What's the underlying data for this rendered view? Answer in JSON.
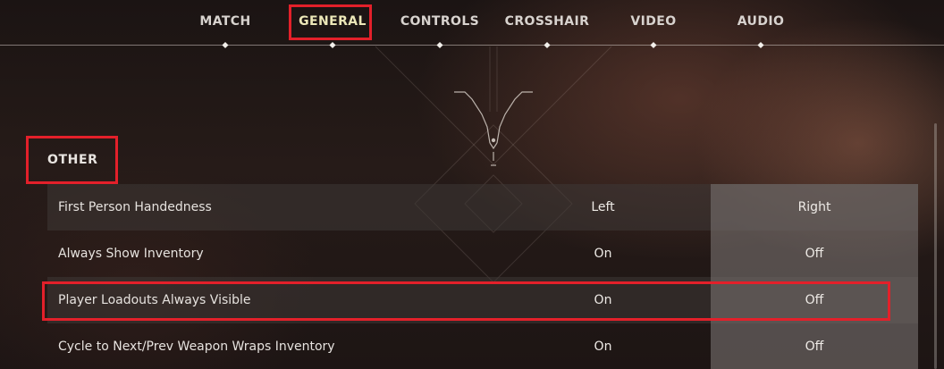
{
  "nav": {
    "tabs": [
      {
        "label": "MATCH",
        "active": false
      },
      {
        "label": "GENERAL",
        "active": true
      },
      {
        "label": "CONTROLS",
        "active": false
      },
      {
        "label": "CROSSHAIR",
        "active": false
      },
      {
        "label": "VIDEO",
        "active": false
      },
      {
        "label": "AUDIO",
        "active": false
      }
    ]
  },
  "section": {
    "title": "OTHER"
  },
  "settings": [
    {
      "label": "First Person Handedness",
      "left": "Left",
      "right": "Right",
      "selected": "right"
    },
    {
      "label": "Always Show Inventory",
      "left": "On",
      "right": "Off",
      "selected": "right"
    },
    {
      "label": "Player Loadouts Always Visible",
      "left": "On",
      "right": "Off",
      "selected": "right"
    },
    {
      "label": "Cycle to Next/Prev Weapon Wraps Inventory",
      "left": "On",
      "right": "Off",
      "selected": "right"
    }
  ],
  "colors": {
    "active_tab": "#ece7b8",
    "highlight": "#e3202a"
  }
}
